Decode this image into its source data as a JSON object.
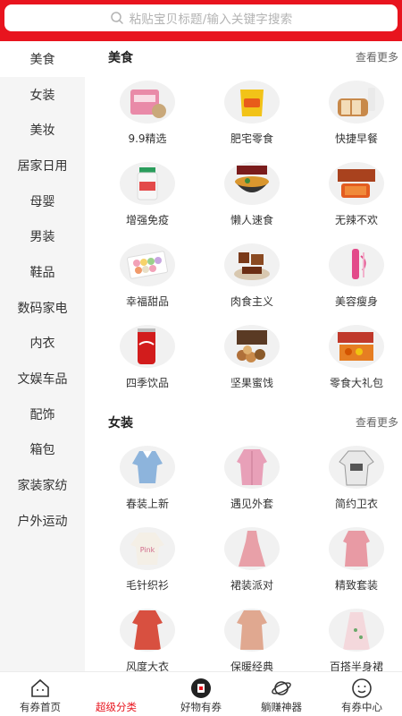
{
  "search": {
    "placeholder": "粘贴宝贝标题/输入关键字搜索"
  },
  "colors": {
    "brand": "#e8141e",
    "sidebar_bg": "#f5f5f5",
    "active_tab": "#e8141e"
  },
  "sidebar": {
    "items": [
      {
        "label": "美食",
        "active": true
      },
      {
        "label": "女装"
      },
      {
        "label": "美妆"
      },
      {
        "label": "居家日用"
      },
      {
        "label": "母婴"
      },
      {
        "label": "男装"
      },
      {
        "label": "鞋品"
      },
      {
        "label": "数码家电"
      },
      {
        "label": "内衣"
      },
      {
        "label": "文娱车品"
      },
      {
        "label": "配饰"
      },
      {
        "label": "箱包"
      },
      {
        "label": "家装家纺"
      },
      {
        "label": "户外运动"
      }
    ]
  },
  "sections": [
    {
      "title": "美食",
      "more": "查看更多",
      "items": [
        {
          "label": "9.9精选",
          "icon": "snack-bag-icon"
        },
        {
          "label": "肥宅零食",
          "icon": "chips-icon"
        },
        {
          "label": "快捷早餐",
          "icon": "bread-icon"
        },
        {
          "label": "增强免疫",
          "icon": "supplement-jar-icon"
        },
        {
          "label": "懒人速食",
          "icon": "noodle-bowl-icon"
        },
        {
          "label": "无辣不欢",
          "icon": "spicy-meat-icon"
        },
        {
          "label": "幸福甜品",
          "icon": "macaron-icon"
        },
        {
          "label": "肉食主义",
          "icon": "braised-meat-icon"
        },
        {
          "label": "美容瘦身",
          "icon": "beauty-drink-icon"
        },
        {
          "label": "四季饮品",
          "icon": "cola-can-icon"
        },
        {
          "label": "坚果蜜饯",
          "icon": "nuts-icon"
        },
        {
          "label": "零食大礼包",
          "icon": "gift-box-icon"
        }
      ]
    },
    {
      "title": "女装",
      "more": "查看更多",
      "items": [
        {
          "label": "春装上新",
          "icon": "blouse-icon"
        },
        {
          "label": "遇见外套",
          "icon": "pink-jacket-icon"
        },
        {
          "label": "简约卫衣",
          "icon": "hoodie-icon"
        },
        {
          "label": "毛针织衫",
          "icon": "sweater-icon"
        },
        {
          "label": "裙装派对",
          "icon": "dress-icon"
        },
        {
          "label": "精致套装",
          "icon": "suit-set-icon"
        },
        {
          "label": "风度大衣",
          "icon": "red-coat-icon"
        },
        {
          "label": "保暖经典",
          "icon": "puffer-coat-icon"
        },
        {
          "label": "百搭半身裙",
          "icon": "skirt-icon"
        }
      ]
    }
  ],
  "tabbar": {
    "items": [
      {
        "label": "有券首页",
        "icon": "home-icon"
      },
      {
        "label": "超级分类",
        "icon": "category-icon",
        "active": true
      },
      {
        "label": "好物有券",
        "icon": "coupon-icon"
      },
      {
        "label": "躺赚神器",
        "icon": "planet-icon"
      },
      {
        "label": "有券中心",
        "icon": "smile-icon"
      }
    ]
  }
}
